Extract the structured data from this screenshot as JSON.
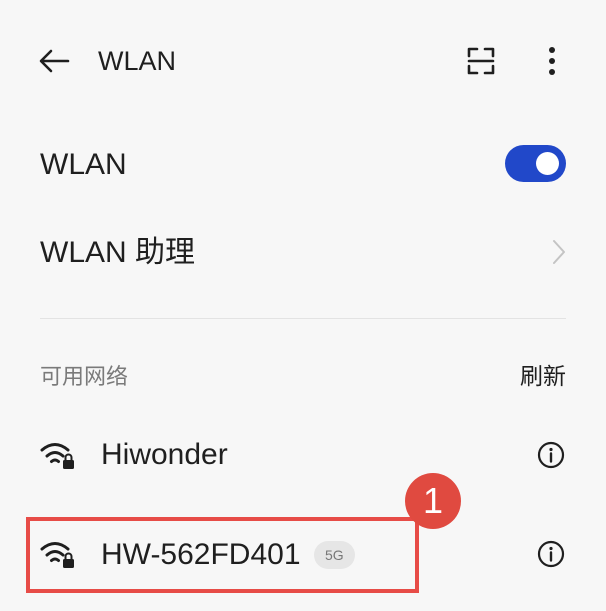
{
  "header": {
    "title": "WLAN",
    "back_icon": "arrow-left-icon",
    "scan_icon": "scan-qr-icon",
    "more_icon": "more-vertical-icon"
  },
  "settings": {
    "wlan_toggle": {
      "label": "WLAN",
      "state": "on",
      "accent_color": "#2148c9"
    },
    "wlan_assistant": {
      "label": "WLAN 助理",
      "icon": "chevron-right-icon"
    }
  },
  "networks": {
    "section_label": "可用网络",
    "refresh_label": "刷新",
    "items": [
      {
        "name": "Hiwonder",
        "badge": "",
        "signal_icon": "wifi-lock-icon",
        "info_icon": "info-icon"
      },
      {
        "name": "HW-562FD401",
        "badge": "5G",
        "signal_icon": "wifi-lock-icon",
        "info_icon": "info-icon"
      }
    ]
  },
  "annotation": {
    "marker_number": "1",
    "color": "#e74c47"
  }
}
